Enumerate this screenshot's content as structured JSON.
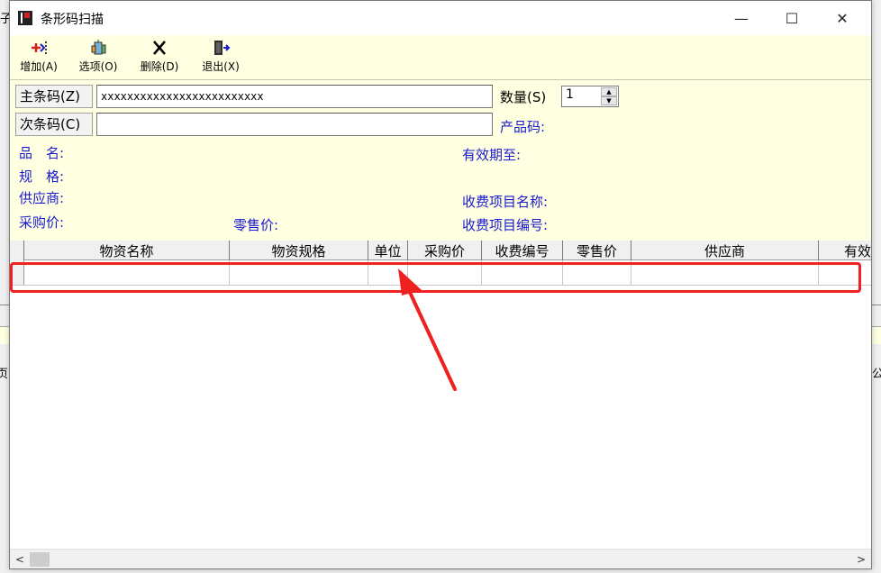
{
  "window": {
    "title": "条形码扫描",
    "controls": {
      "minimize": "—",
      "maximize": "☐",
      "close": "✕"
    }
  },
  "background": {
    "frag_top_left": "子",
    "frag_mid_left": "页",
    "frag_mid_right": "公"
  },
  "toolbar": {
    "add_label": "增加(A)",
    "options_label": "选项(O)",
    "delete_label": "删除(D)",
    "exit_label": "退出(X)"
  },
  "form": {
    "main_barcode_label": "主条码(Z)",
    "main_barcode_value": "xxxxxxxxxxxxxxxxxxxxxxxxx",
    "sub_barcode_label": "次条码(C)",
    "sub_barcode_value": "",
    "quantity_label": "数量(S)",
    "quantity_value": "1",
    "product_code_label": "产品码:",
    "name_label": "品　名:",
    "spec_label": "规　格:",
    "supplier_label": "供应商:",
    "purchase_price_label": "采购价:",
    "retail_price_label": "零售价:",
    "expiry_label": "有效期至:",
    "fee_item_name_label": "收费项目名称:",
    "fee_item_code_label": "收费项目编号:"
  },
  "grid": {
    "columns": [
      "物资名称",
      "物资规格",
      "单位",
      "采购价",
      "收费编号",
      "零售价",
      "供应商",
      "有效"
    ]
  },
  "scrollbar": {
    "left": "<",
    "right": ">"
  },
  "colors": {
    "toolbar_bg": "#ffffe1",
    "label_blue": "#1a1ad0",
    "highlight_red": "#ee2020"
  }
}
